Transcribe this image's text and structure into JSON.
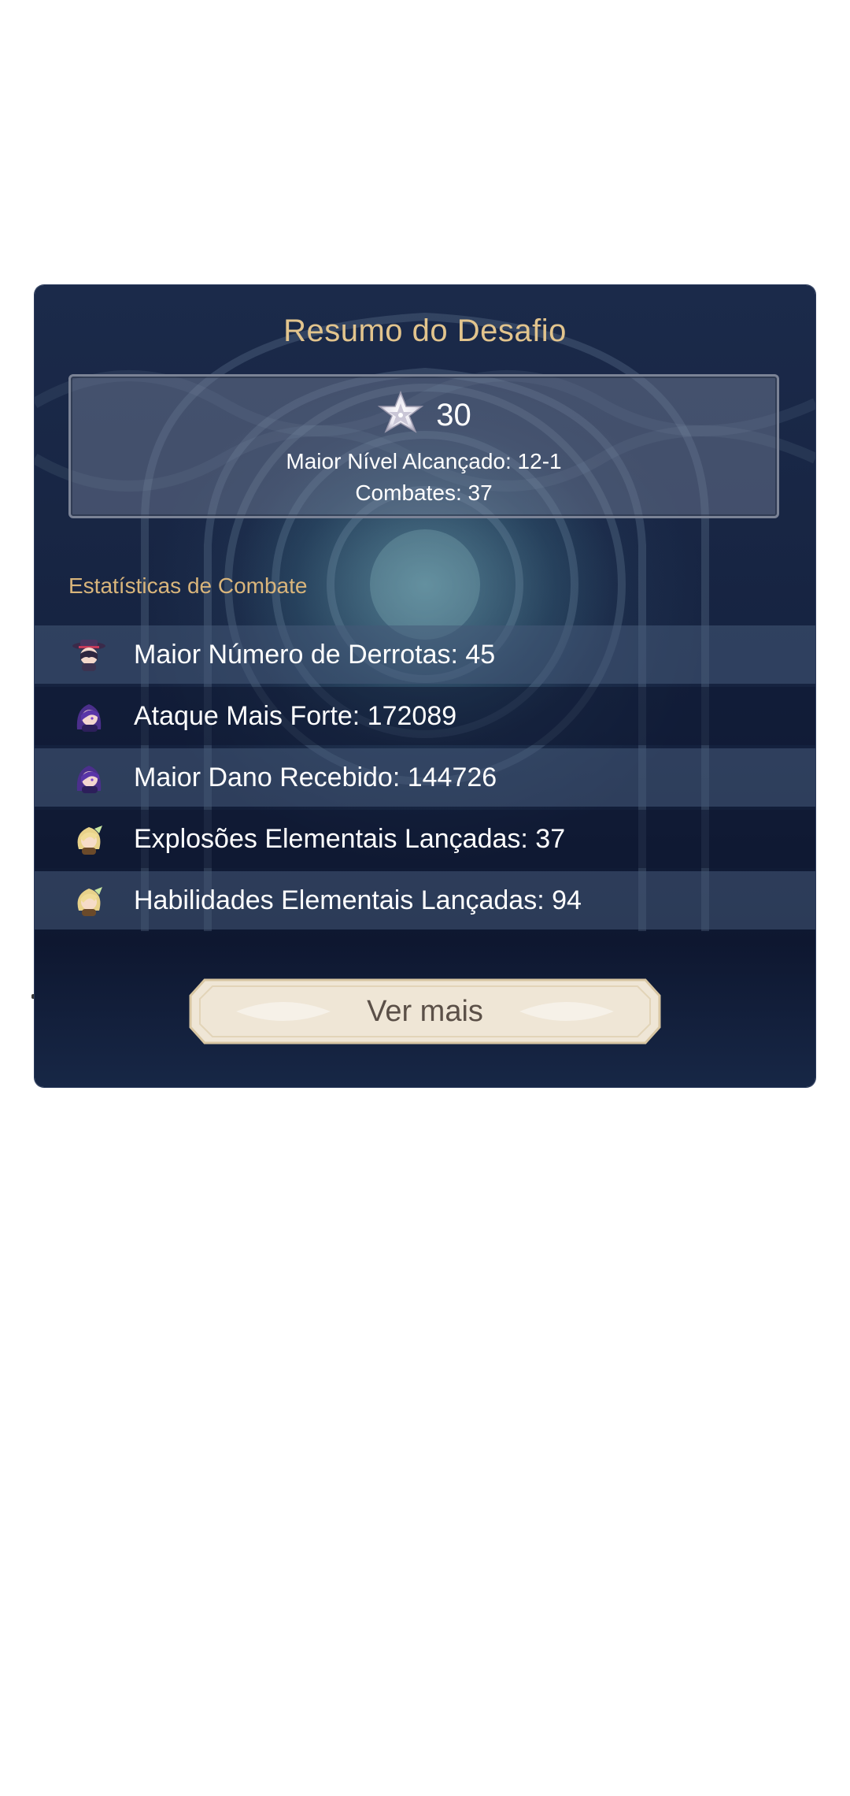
{
  "panel": {
    "title": "Resumo do Desafio"
  },
  "summary": {
    "stars": "30",
    "star_icon": "abyss-star-icon",
    "highest_level": "Maior Nível Alcançado: 12-1",
    "battles": "Combates: 37"
  },
  "combat_stats": {
    "label": "Estatísticas de Combate",
    "rows": [
      {
        "text": "Maior Número de Derrotas: 45",
        "icon": "character-avatar-icon"
      },
      {
        "text": "Ataque Mais Forte: 172089",
        "icon": "character-avatar-icon"
      },
      {
        "text": "Maior Dano Recebido: 144726",
        "icon": "character-avatar-icon"
      },
      {
        "text": "Explosões Elementais Lançadas: 37",
        "icon": "character-avatar-icon"
      },
      {
        "text": "Habilidades Elementais Lançadas: 94",
        "icon": "character-avatar-icon"
      }
    ]
  },
  "actions": {
    "more_label": "Ver mais"
  },
  "colors": {
    "title": "#e2c48d",
    "section_label": "#d9b57b",
    "panel_bg": "#15223f",
    "button_bg": "#efe6d6",
    "button_text": "#5b5048"
  }
}
